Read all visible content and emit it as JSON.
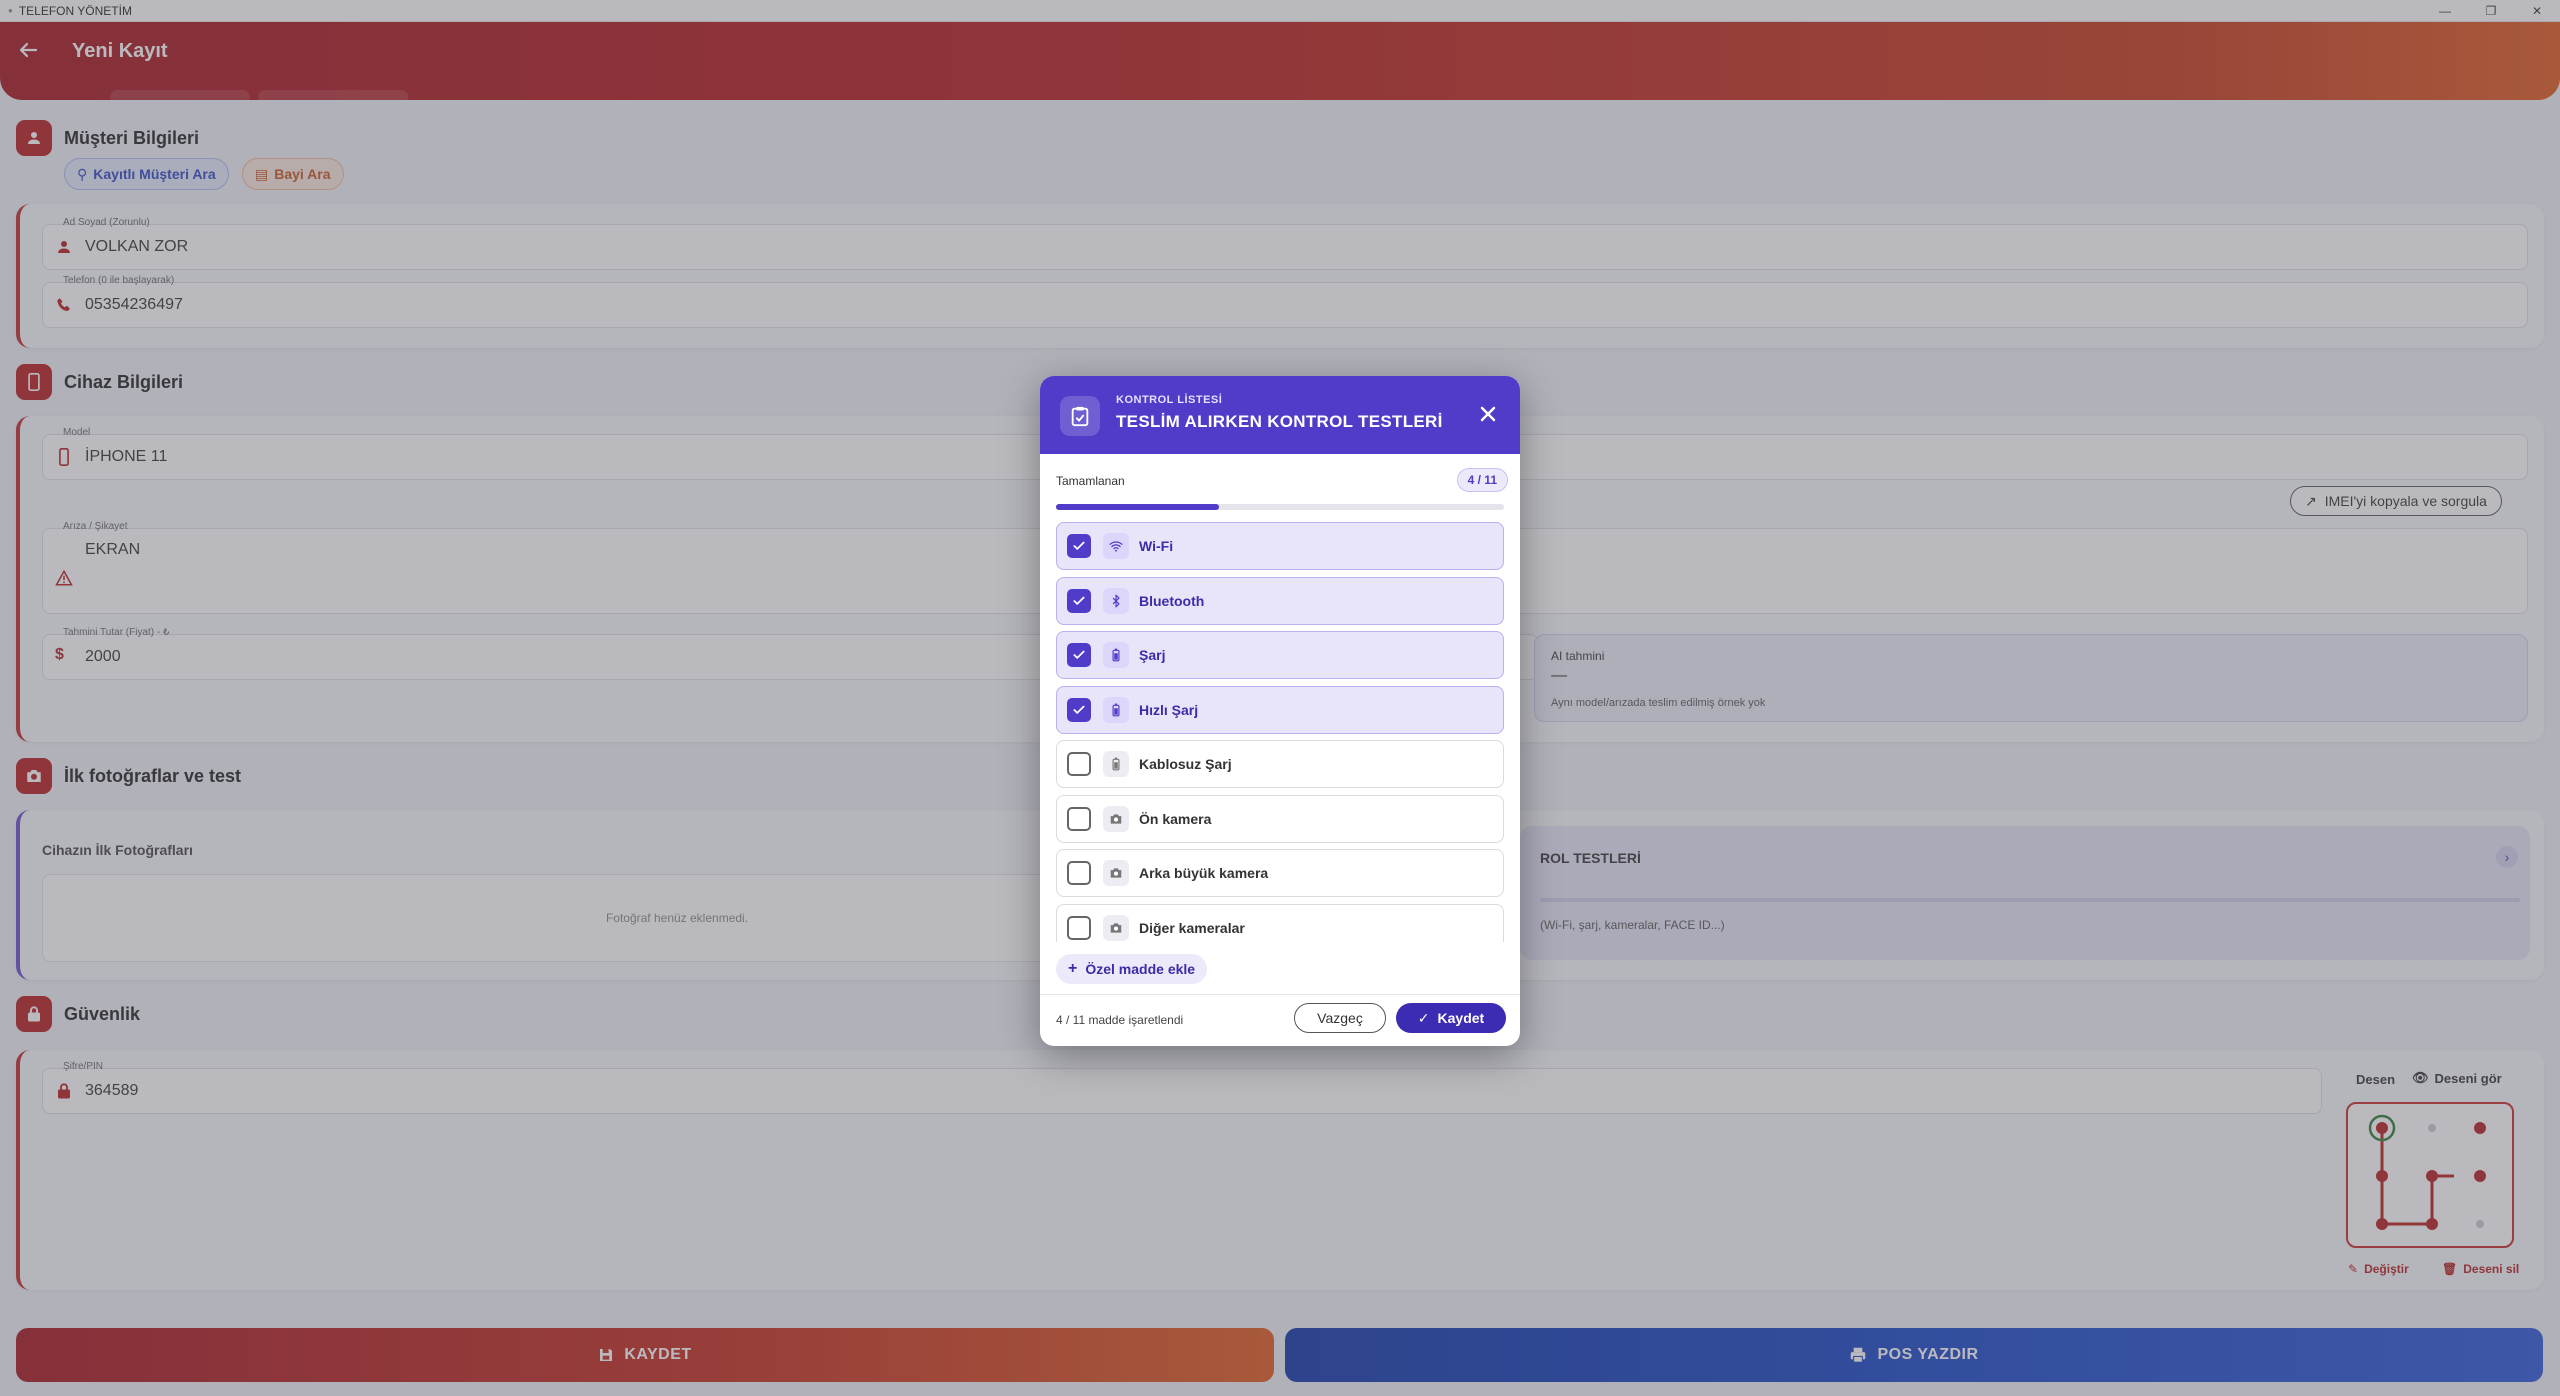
{
  "window": {
    "title": "TELEFON YÖNETİM"
  },
  "appbar": {
    "title": "Yeni Kayıt"
  },
  "customer": {
    "title": "Müşteri Bilgileri",
    "search_registered": "Kayıtlı Müşteri Ara",
    "search_dealer": "Bayi Ara",
    "name_label": "Ad Soyad (Zorunlu)",
    "name_value": "VOLKAN ZOR",
    "phone_label": "Telefon (0 ile başlayarak)",
    "phone_value": "05354236497"
  },
  "device": {
    "title": "Cihaz Bilgileri",
    "model_label": "Model",
    "model_value": "İPHONE 11",
    "imei_button": "IMEI'yi kopyala ve sorgula",
    "issue_label": "Arıza / Şikayet",
    "issue_value": "EKRAN",
    "price_label": "Tahmini Tutar (Fiyat) - ₺",
    "price_value": "2000",
    "ai_title": "AI tahmini",
    "ai_value": "—",
    "ai_note": "Aynı model/arızada teslim edilmiş örnek yok"
  },
  "photos": {
    "title": "İlk fotoğraflar ve test",
    "photos_label": "Cihazın İlk Fotoğrafları",
    "empty": "Fotoğraf henüz eklenmedi.",
    "tests_title_partial": "ROL TESTLERİ",
    "tests_sub_partial": "(Wi-Fi, şarj, kameralar, FACE ID...)"
  },
  "security": {
    "title": "Güvenlik",
    "pin_label": "Şifre/PIN",
    "pin_value": "364589",
    "pattern_label": "Desen",
    "show_pattern": "Deseni gör",
    "change": "Değiştir",
    "delete_pattern": "Deseni sil"
  },
  "bottom": {
    "save": "KAYDET",
    "print": "POS YAZDIR"
  },
  "modal": {
    "kicker": "KONTROL LİSTESİ",
    "title": "TESLİM ALIRKEN KONTROL TESTLERİ",
    "progress_label": "Tamamlanan",
    "count": "4 / 11",
    "progress": 0.3636,
    "items": [
      {
        "label": "Wi-Fi",
        "checked": true,
        "icon": "wifi-icon"
      },
      {
        "label": "Bluetooth",
        "checked": true,
        "icon": "bluetooth-icon"
      },
      {
        "label": "Şarj",
        "checked": true,
        "icon": "battery-icon"
      },
      {
        "label": "Hızlı Şarj",
        "checked": true,
        "icon": "battery-icon"
      },
      {
        "label": "Kablosuz Şarj",
        "checked": false,
        "icon": "battery-icon"
      },
      {
        "label": "Ön kamera",
        "checked": false,
        "icon": "camera-icon"
      },
      {
        "label": "Arka büyük kamera",
        "checked": false,
        "icon": "camera-icon"
      },
      {
        "label": "Diğer kameralar",
        "checked": false,
        "icon": "camera-icon"
      }
    ],
    "add_custom": "Özel madde ekle",
    "footer_status": "4 / 11 madde işaretlendi",
    "cancel": "Vazgeç",
    "save": "Kaydet"
  },
  "colors": {
    "primary_red": "#b71c1c",
    "modal_purple": "#4f3cc9",
    "print_blue": "#1745c7"
  }
}
